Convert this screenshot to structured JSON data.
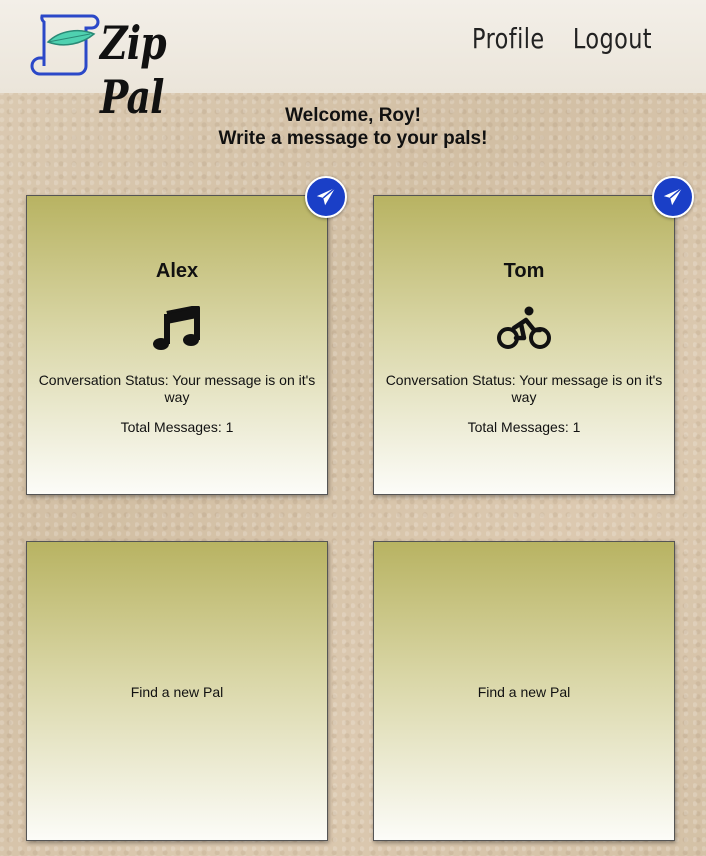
{
  "header": {
    "brand": "Zip Pal",
    "nav": {
      "profile": "Profile",
      "logout": "Logout"
    }
  },
  "welcome": {
    "line1": "Welcome, Roy!",
    "line2": "Write a message to your pals!"
  },
  "pals": [
    {
      "name": "Alex",
      "icon": "music-note-icon",
      "status": "Conversation Status: Your message is on it's way",
      "total": "Total Messages: 1"
    },
    {
      "name": "Tom",
      "icon": "cyclist-icon",
      "status": "Conversation Status: Your message is on it's way",
      "total": "Total Messages: 1"
    }
  ],
  "empty_slots": [
    {
      "label": "Find a new Pal"
    },
    {
      "label": "Find a new Pal"
    }
  ],
  "colors": {
    "accent": "#1a3fc7",
    "card_top": "#b8b362",
    "card_bottom": "#fcfcf8"
  }
}
